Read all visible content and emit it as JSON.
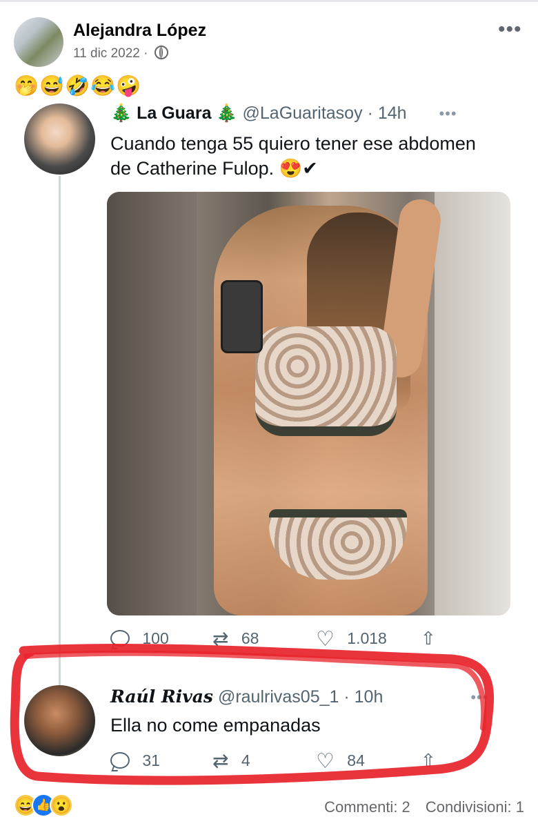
{
  "post": {
    "author": "Alejandra López",
    "date": "11 dic 2022",
    "dot": "·",
    "more": "•••",
    "emoji_caption": "🤭😅🤣😂🤪"
  },
  "tweet1": {
    "name_prefix": "🎄",
    "name": "La Guara",
    "name_suffix": "🎄",
    "handle": "@LaGuaritasoy",
    "time": "· 14h",
    "more": "•••",
    "text": "Cuando tenga 55 quiero tener ese abdomen de Catherine Fulop. 😍✔",
    "replies": "100",
    "retweets": "68",
    "likes": "1.018"
  },
  "tweet2": {
    "name": "Raúl Rivas",
    "handle": "@raulrivas05_1",
    "time": "· 10h",
    "more": "•••",
    "text": "Ella no come empanadas",
    "replies": "31",
    "retweets": "4",
    "likes": "84"
  },
  "icons": {
    "reply": "reply-icon",
    "retweet": "retweet-icon",
    "like": "heart-icon",
    "share": "share-icon",
    "globe": "globe-icon"
  },
  "footer": {
    "reactions": [
      "😄",
      "👍",
      "😮"
    ],
    "comments": "Commenti: 2",
    "shares": "Condivisioni: 1"
  },
  "colors": {
    "highlight": "#e8232b",
    "secondary_text": "#65676b",
    "twitter_gray": "#536471"
  }
}
